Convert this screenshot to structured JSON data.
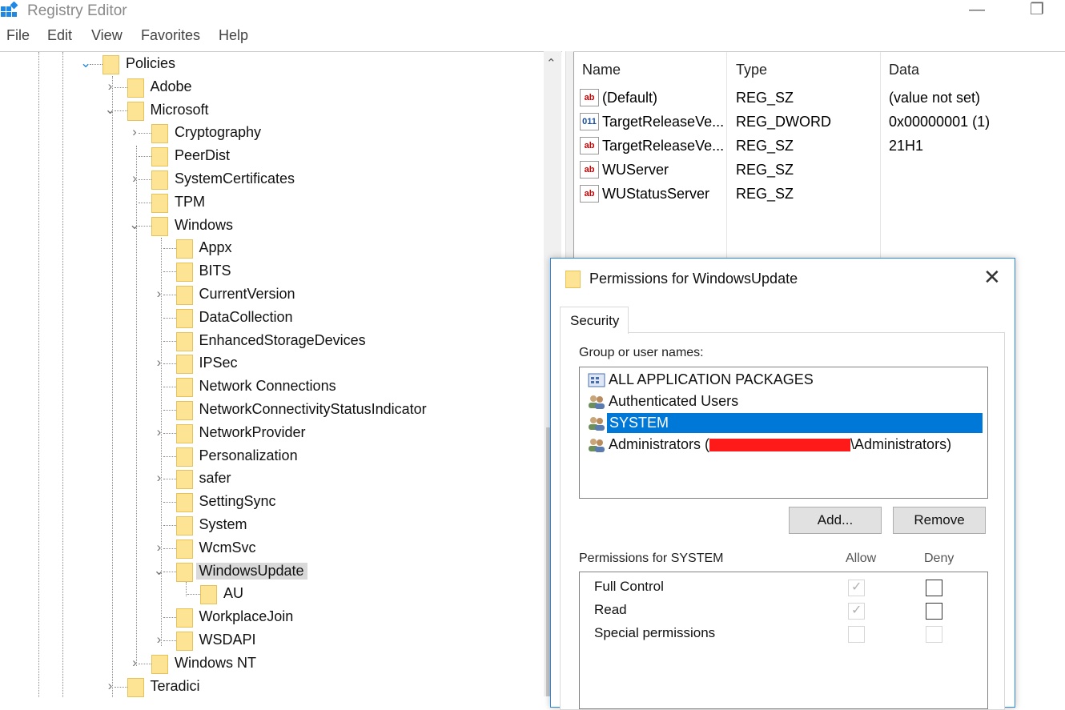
{
  "window": {
    "title": "Registry Editor",
    "minimize_glyph": "—",
    "restore_glyph": "❐"
  },
  "menu": [
    "File",
    "Edit",
    "View",
    "Favorites",
    "Help"
  ],
  "tree": {
    "expanders": {
      "expanded": "⌄",
      "collapsed": "›"
    },
    "nodes": [
      {
        "label": "Policies",
        "state": "expanded"
      },
      {
        "label": "Adobe",
        "state": "collapsed"
      },
      {
        "label": "Microsoft",
        "state": "expanded"
      },
      {
        "label": "Cryptography",
        "state": "collapsed"
      },
      {
        "label": "PeerDist",
        "state": "leaf"
      },
      {
        "label": "SystemCertificates",
        "state": "collapsed"
      },
      {
        "label": "TPM",
        "state": "leaf"
      },
      {
        "label": "Windows",
        "state": "expanded"
      },
      {
        "label": "Appx",
        "state": "leaf"
      },
      {
        "label": "BITS",
        "state": "leaf"
      },
      {
        "label": "CurrentVersion",
        "state": "collapsed"
      },
      {
        "label": "DataCollection",
        "state": "leaf"
      },
      {
        "label": "EnhancedStorageDevices",
        "state": "leaf"
      },
      {
        "label": "IPSec",
        "state": "collapsed"
      },
      {
        "label": "Network Connections",
        "state": "leaf"
      },
      {
        "label": "NetworkConnectivityStatusIndicator",
        "state": "leaf"
      },
      {
        "label": "NetworkProvider",
        "state": "collapsed"
      },
      {
        "label": "Personalization",
        "state": "leaf"
      },
      {
        "label": "safer",
        "state": "collapsed"
      },
      {
        "label": "SettingSync",
        "state": "leaf"
      },
      {
        "label": "System",
        "state": "leaf"
      },
      {
        "label": "WcmSvc",
        "state": "collapsed"
      },
      {
        "label": "WindowsUpdate",
        "state": "expanded",
        "selected": true
      },
      {
        "label": "AU",
        "state": "leaf"
      },
      {
        "label": "WorkplaceJoin",
        "state": "leaf"
      },
      {
        "label": "WSDAPI",
        "state": "collapsed"
      },
      {
        "label": "Windows NT",
        "state": "collapsed"
      },
      {
        "label": "Teradici",
        "state": "collapsed"
      }
    ]
  },
  "values_list": {
    "columns": [
      "Name",
      "Type",
      "Data"
    ],
    "rows": [
      {
        "icon": "string-value-icon",
        "icon_text": "ab",
        "name": "(Default)",
        "type": "REG_SZ",
        "data": "(value not set)"
      },
      {
        "icon": "binary-value-icon",
        "icon_text": "011",
        "name": "TargetReleaseVe...",
        "type": "REG_DWORD",
        "data": "0x00000001 (1)"
      },
      {
        "icon": "string-value-icon",
        "icon_text": "ab",
        "name": "TargetReleaseVe...",
        "type": "REG_SZ",
        "data": "21H1"
      },
      {
        "icon": "string-value-icon",
        "icon_text": "ab",
        "name": "WUServer",
        "type": "REG_SZ",
        "data": ""
      },
      {
        "icon": "string-value-icon",
        "icon_text": "ab",
        "name": "WUStatusServer",
        "type": "REG_SZ",
        "data": ""
      }
    ]
  },
  "dialog": {
    "title": "Permissions for WindowsUpdate",
    "close_glyph": "✕",
    "tab": "Security",
    "group_label": "Group or user names:",
    "users": [
      {
        "name": "ALL APPLICATION PACKAGES",
        "icon": "app-packages-icon"
      },
      {
        "name": "Authenticated Users",
        "icon": "users-icon"
      },
      {
        "name": "SYSTEM",
        "icon": "users-icon",
        "selected": true
      },
      {
        "name_prefix": "Administrators (",
        "name_suffix": "\\Administrators)",
        "redacted": true,
        "icon": "users-icon"
      }
    ],
    "add_button": "Add...",
    "remove_button": "Remove",
    "perm_header": "Permissions for SYSTEM",
    "allow_header": "Allow",
    "deny_header": "Deny",
    "permissions": [
      {
        "name": "Full Control",
        "allow": true,
        "allow_disabled": true,
        "deny": false,
        "deny_disabled": false
      },
      {
        "name": "Read",
        "allow": true,
        "allow_disabled": true,
        "deny": false,
        "deny_disabled": false
      },
      {
        "name": "Special permissions",
        "allow": false,
        "allow_disabled": true,
        "deny": false,
        "deny_disabled": true
      }
    ],
    "check_glyph": "✓"
  }
}
